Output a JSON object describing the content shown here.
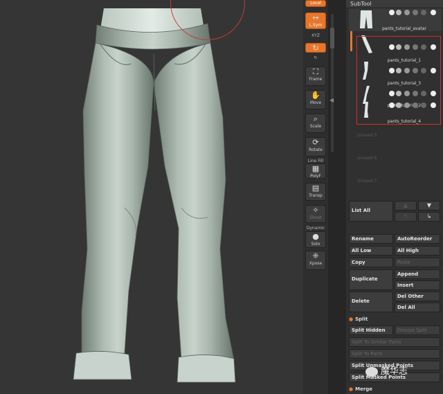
{
  "shelf": {
    "local": "Local",
    "lsym": "L.Sym",
    "xyz": "XYZ",
    "frame": "Frame",
    "move": "Move",
    "scale": "Scale",
    "rotate": "Rotate",
    "line_fill": "Line Fill",
    "polyf": "PolyF",
    "transp": "Transp",
    "ghost": "Ghost",
    "dynamic": "Dynamic",
    "solo": "Solo",
    "xpose": "Xpose"
  },
  "subtool": {
    "header": "SubTool",
    "items": [
      {
        "name": "pants_tutorial_avatar"
      },
      {
        "name": "pants_tutorial_1"
      },
      {
        "name": "pants_tutorial_3"
      },
      {
        "name": "pants_tutorial_2"
      },
      {
        "name": "pants_tutorial_4"
      }
    ],
    "unused": [
      "Unused 5",
      "Unused 6",
      "Unused 7"
    ],
    "list_all": "List All",
    "arrows": {
      "up": "▲",
      "down": "▼",
      "left": "↰",
      "right": "↳"
    },
    "rename": "Rename",
    "autoreorder": "AutoReorder",
    "all_low": "All Low",
    "all_high": "All High",
    "copy": "Copy",
    "paste": "Paste",
    "duplicate": "Duplicate",
    "append": "Append",
    "insert": "Insert",
    "delete": "Delete",
    "del_other": "Del Other",
    "del_all": "Del All"
  },
  "split": {
    "section": "Split",
    "split_hidden": "Split Hidden",
    "groups_split": "Groups Split",
    "split_similar": "Split To Similar Parts",
    "split_parts": "Split To Parts",
    "split_masked": "Split Unmasked Points",
    "split_unmasked": "Split Masked Points"
  },
  "merge": {
    "section": "Merge"
  },
  "watermark": "魔华志",
  "colors": {
    "accent": "#e8772b",
    "highlight": "#d0302a"
  }
}
